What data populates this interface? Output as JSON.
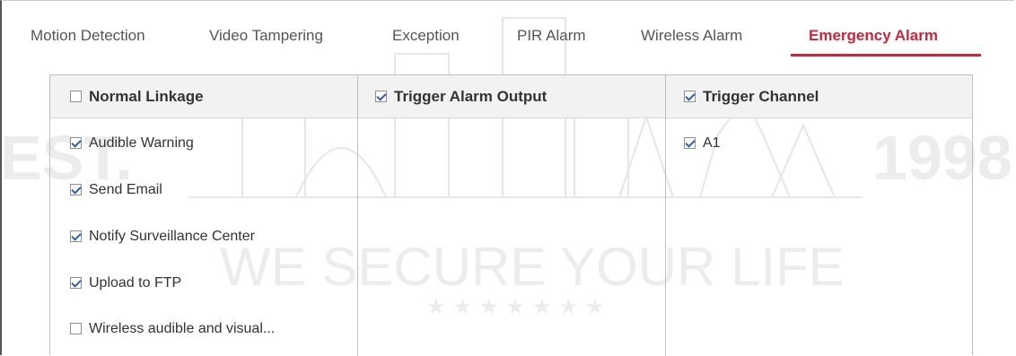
{
  "tabs": [
    {
      "label": "Motion Detection",
      "active": false
    },
    {
      "label": "Video Tampering",
      "active": false
    },
    {
      "label": "Exception",
      "active": false
    },
    {
      "label": "PIR Alarm",
      "active": false
    },
    {
      "label": "Wireless Alarm",
      "active": false
    },
    {
      "label": "Emergency Alarm",
      "active": true
    }
  ],
  "accent_color": "#c8273a",
  "watermark": {
    "text": "WE SECURE YOUR LIFE",
    "left_fragment": "EST.",
    "right_fragment": "1998"
  },
  "columns": {
    "normal_linkage": {
      "label": "Normal Linkage",
      "checked": false,
      "items": [
        {
          "label": "Audible Warning",
          "checked": true
        },
        {
          "label": "Send Email",
          "checked": true
        },
        {
          "label": "Notify Surveillance Center",
          "checked": true
        },
        {
          "label": "Upload to FTP",
          "checked": true
        },
        {
          "label": "Wireless audible and visual...",
          "checked": false
        }
      ]
    },
    "trigger_alarm_output": {
      "label": "Trigger Alarm Output",
      "checked": true,
      "items": []
    },
    "trigger_channel": {
      "label": "Trigger Channel",
      "checked": true,
      "items": [
        {
          "label": "A1",
          "checked": true
        }
      ]
    }
  }
}
